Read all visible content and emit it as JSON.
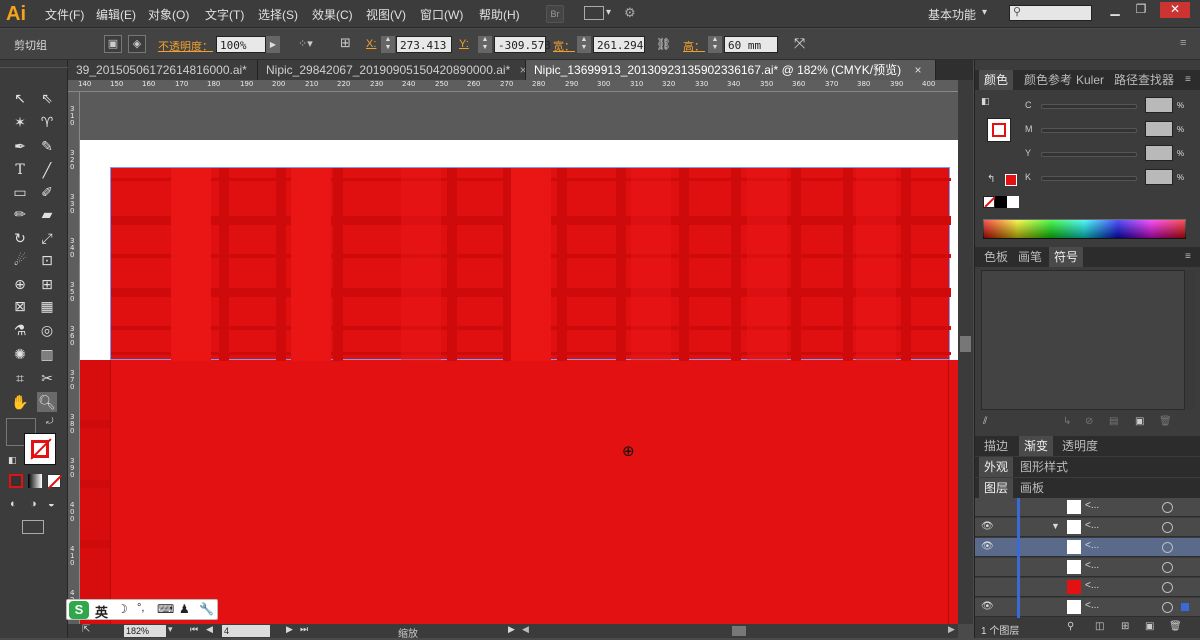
{
  "app": {
    "logo": "Ai"
  },
  "menu": {
    "items": [
      "文件(F)",
      "编辑(E)",
      "对象(O)",
      "文字(T)",
      "选择(S)",
      "效果(C)",
      "视图(V)",
      "窗口(W)",
      "帮助(H)"
    ],
    "br_badge": "Br",
    "workspace": "基本功能",
    "chevron": "▾"
  },
  "control": {
    "group_label": "剪切组",
    "opacity_label": "不透明度：",
    "opacity_value": "100%",
    "x_label": "X:",
    "x_value": "273.413",
    "y_label": "Y:",
    "y_value": "-309.573",
    "w_label": "宽：",
    "w_value": "261.294",
    "h_label": "高：",
    "h_value": "60 mm",
    "unit_x": "r",
    "unit_y": "r",
    "unit_w": "m"
  },
  "tabs": [
    {
      "label": "39_20150506172614816000.ai*",
      "close": "×"
    },
    {
      "label": "Nipic_29842067_20190905150420890000.ai*",
      "close": "×"
    },
    {
      "label": "Nipic_13699913_20130923135902336167.ai* @ 182% (CMYK/预览)",
      "close": "×"
    }
  ],
  "ruler": {
    "h_numbers": [
      "140",
      "150",
      "160",
      "170",
      "180",
      "190",
      "200",
      "210",
      "220",
      "230",
      "240",
      "250",
      "260",
      "270",
      "280",
      "290",
      "300",
      "310",
      "320",
      "330",
      "340",
      "350",
      "360",
      "370",
      "380",
      "390",
      "400"
    ],
    "v_numbers": [
      "3\n1\n0",
      "3\n2\n0",
      "3\n3\n0",
      "3\n4\n0",
      "3\n5\n0",
      "3\n6\n0",
      "3\n7\n0",
      "3\n8\n0",
      "3\n9\n0",
      "4\n0\n0",
      "4\n1\n0",
      "4\n2\n0"
    ]
  },
  "color_panel": {
    "tabs": [
      "颜色",
      "颜色参考",
      "Kuler",
      "路径查找器"
    ],
    "channels": [
      {
        "name": "C",
        "value": "",
        "unit": "%"
      },
      {
        "name": "M",
        "value": "",
        "unit": "%"
      },
      {
        "name": "Y",
        "value": "",
        "unit": "%"
      },
      {
        "name": "K",
        "value": "",
        "unit": "%"
      }
    ]
  },
  "swatch_panel": {
    "tabs": [
      "色板",
      "画笔",
      "符号"
    ]
  },
  "stroke_panel": {
    "tabs": [
      "描边",
      "渐变",
      "透明度"
    ]
  },
  "appearance_panel": {
    "tabs": [
      "外观",
      "图形样式"
    ]
  },
  "layers_panel": {
    "tabs": [
      "图层",
      "画板"
    ],
    "row_labels": [
      "<...",
      "<...",
      "<...",
      "<...",
      "<...",
      "<...",
      "<..."
    ],
    "footer": "1 个图层"
  },
  "status": {
    "zoom": "182%",
    "page": "4",
    "tool_name": "缩放"
  },
  "ime": {
    "logo": "S",
    "lang": "英",
    "items": [
      "☽",
      "°,",
      "⌨",
      "♟",
      "🔧"
    ]
  },
  "colors": {
    "red": "#e31111",
    "accent": "#f7a21b",
    "selection": "#6fa0ff"
  }
}
